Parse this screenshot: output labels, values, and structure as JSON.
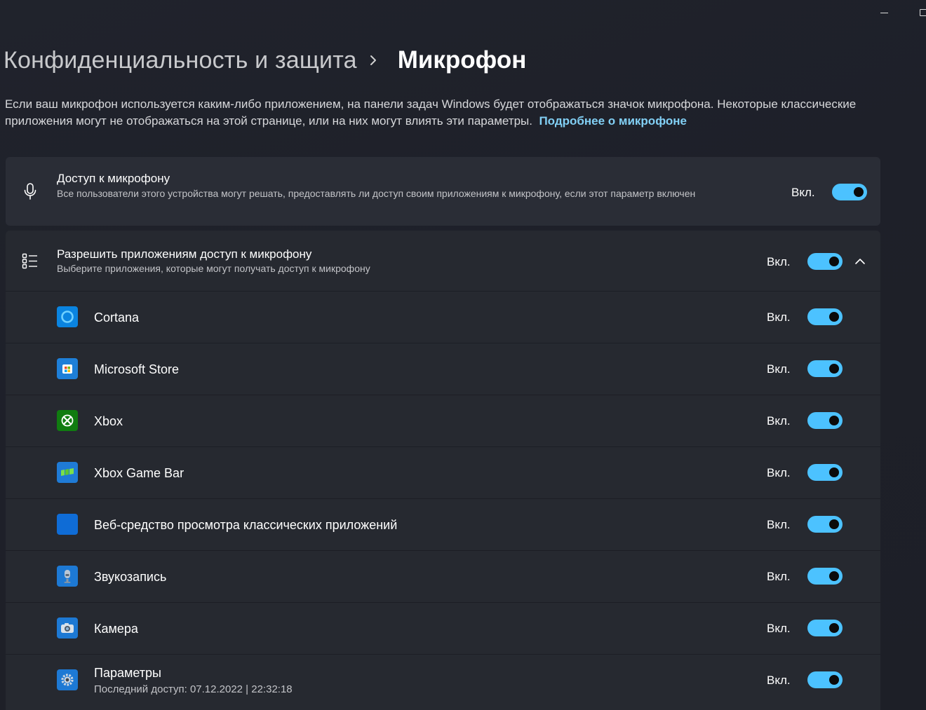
{
  "window": {
    "minimize_icon": "minimize-icon",
    "maximize_icon": "maximize-icon"
  },
  "breadcrumb": {
    "parent": "Конфиденциальность и защита",
    "separator_icon": "chevron-right-icon",
    "current": "Микрофон"
  },
  "description": {
    "text": "Если ваш микрофон используется каким-либо приложением, на панели задач Windows будет отображаться значок микрофона. Некоторые классические приложения могут не отображаться на этой странице, или на них могут влиять эти параметры.",
    "link": "Подробнее о микрофоне"
  },
  "mic_access": {
    "icon": "microphone-icon",
    "title": "Доступ к микрофону",
    "subtitle": "Все пользователи этого устройства могут решать, предоставлять ли доступ своим приложениям к микрофону, если этот параметр включен",
    "state": "Вкл.",
    "enabled": true
  },
  "apps_access": {
    "icon": "list-icon",
    "title": "Разрешить приложениям доступ к микрофону",
    "subtitle": "Выберите приложения, которые могут получать доступ к микрофону",
    "state": "Вкл.",
    "enabled": true,
    "expanded": true,
    "chevron_icon": "chevron-up-icon"
  },
  "apps": [
    {
      "name": "Cortana",
      "icon": "cortana-icon",
      "state": "Вкл.",
      "enabled": true
    },
    {
      "name": "Microsoft Store",
      "icon": "microsoft-store-icon",
      "state": "Вкл.",
      "enabled": true
    },
    {
      "name": "Xbox",
      "icon": "xbox-icon",
      "state": "Вкл.",
      "enabled": true
    },
    {
      "name": "Xbox Game Bar",
      "icon": "xbox-game-bar-icon",
      "state": "Вкл.",
      "enabled": true
    },
    {
      "name": "Веб-средство просмотра классических приложений",
      "icon": "web-viewer-icon",
      "state": "Вкл.",
      "enabled": true
    },
    {
      "name": "Звукозапись",
      "icon": "voice-recorder-icon",
      "state": "Вкл.",
      "enabled": true
    },
    {
      "name": "Камера",
      "icon": "camera-icon",
      "state": "Вкл.",
      "enabled": true
    },
    {
      "name": "Параметры",
      "subtitle": "Последний доступ: 07.12.2022  |  22:32:18",
      "icon": "settings-icon",
      "state": "Вкл.",
      "enabled": true
    }
  ],
  "colors": {
    "accent": "#4cc2ff",
    "link": "#82d0f5",
    "background": "#1f222b",
    "card": "#2a2d36"
  }
}
